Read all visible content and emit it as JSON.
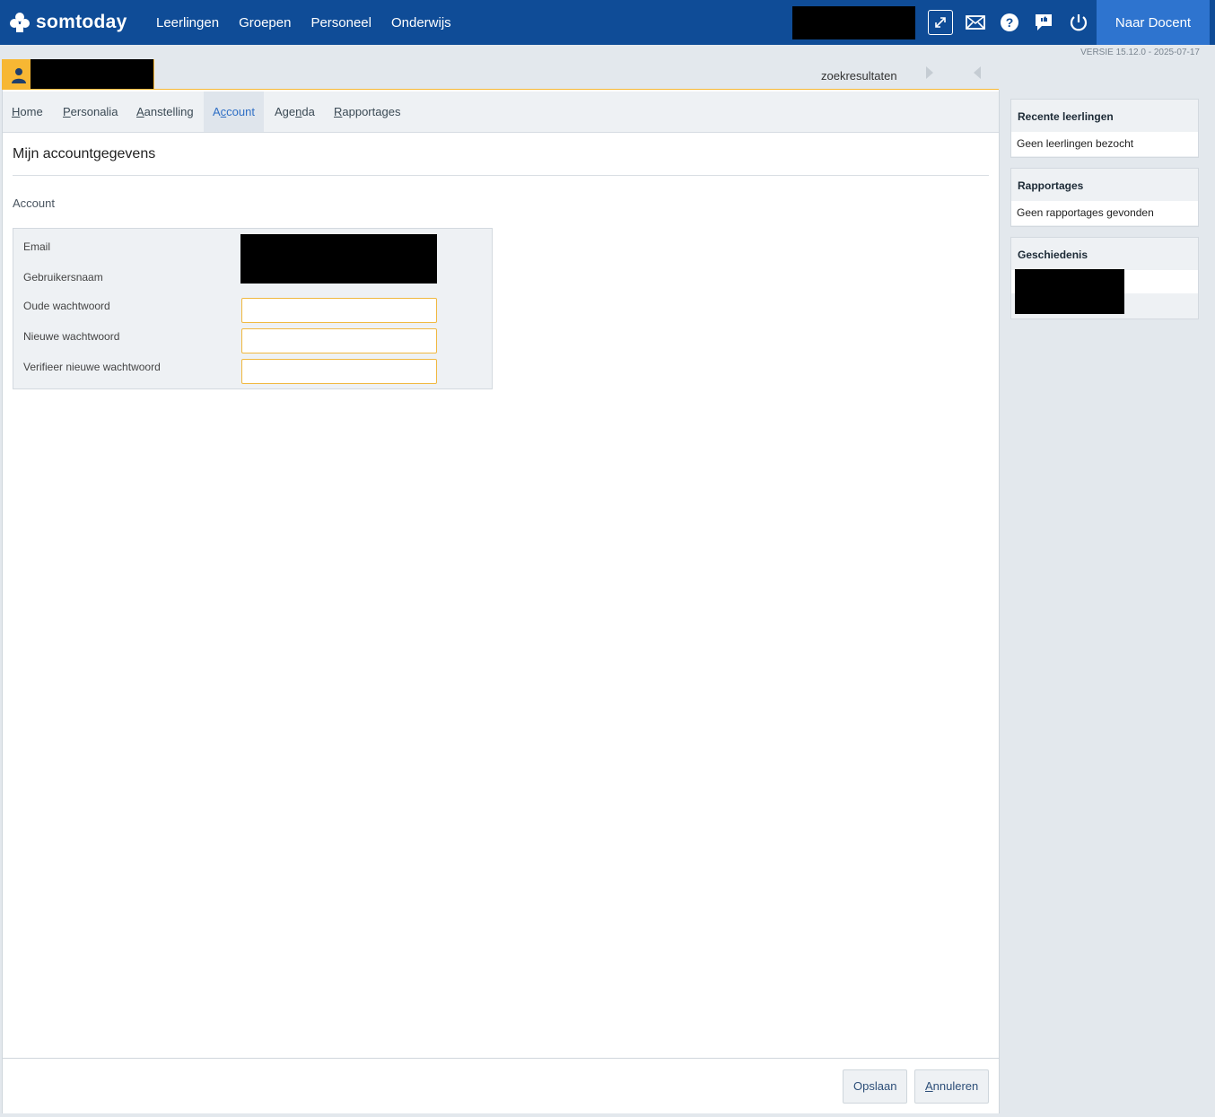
{
  "app": {
    "logo_text": "somtoday",
    "nav": [
      "Leerlingen",
      "Groepen",
      "Personeel",
      "Onderwijs"
    ],
    "docent_button": "Naar Docent",
    "version": "VERSIE 15.12.0 - 2025-07-17",
    "colors": {
      "topbar": "#0f4c97",
      "accent": "#f7b733",
      "button": "#2e74cf"
    }
  },
  "header": {
    "search_results": "zoekresultaten"
  },
  "tabs": [
    {
      "pre": "",
      "u": "H",
      "post": "ome"
    },
    {
      "pre": "",
      "u": "P",
      "post": "ersonalia"
    },
    {
      "pre": "",
      "u": "A",
      "post": "anstelling"
    },
    {
      "pre": "A",
      "u": "c",
      "post": "count"
    },
    {
      "pre": "Age",
      "u": "n",
      "post": "da"
    },
    {
      "pre": "",
      "u": "R",
      "post": "apportages"
    }
  ],
  "page": {
    "title": "Mijn accountgegevens",
    "section": "Account",
    "labels": {
      "email": "Email",
      "username": "Gebruikersnaam",
      "old_password": "Oude wachtwoord",
      "new_password": "Nieuwe wachtwoord",
      "verify_password": "Verifieer nieuwe wachtwoord"
    }
  },
  "footer": {
    "save": "Opslaan",
    "cancel_u": "A",
    "cancel_rest": "nnuleren"
  },
  "sidebar": {
    "recent": {
      "title": "Recente leerlingen",
      "empty": "Geen leerlingen bezocht"
    },
    "reports": {
      "title": "Rapportages",
      "empty": "Geen rapportages gevonden"
    },
    "history": {
      "title": "Geschiedenis"
    }
  }
}
